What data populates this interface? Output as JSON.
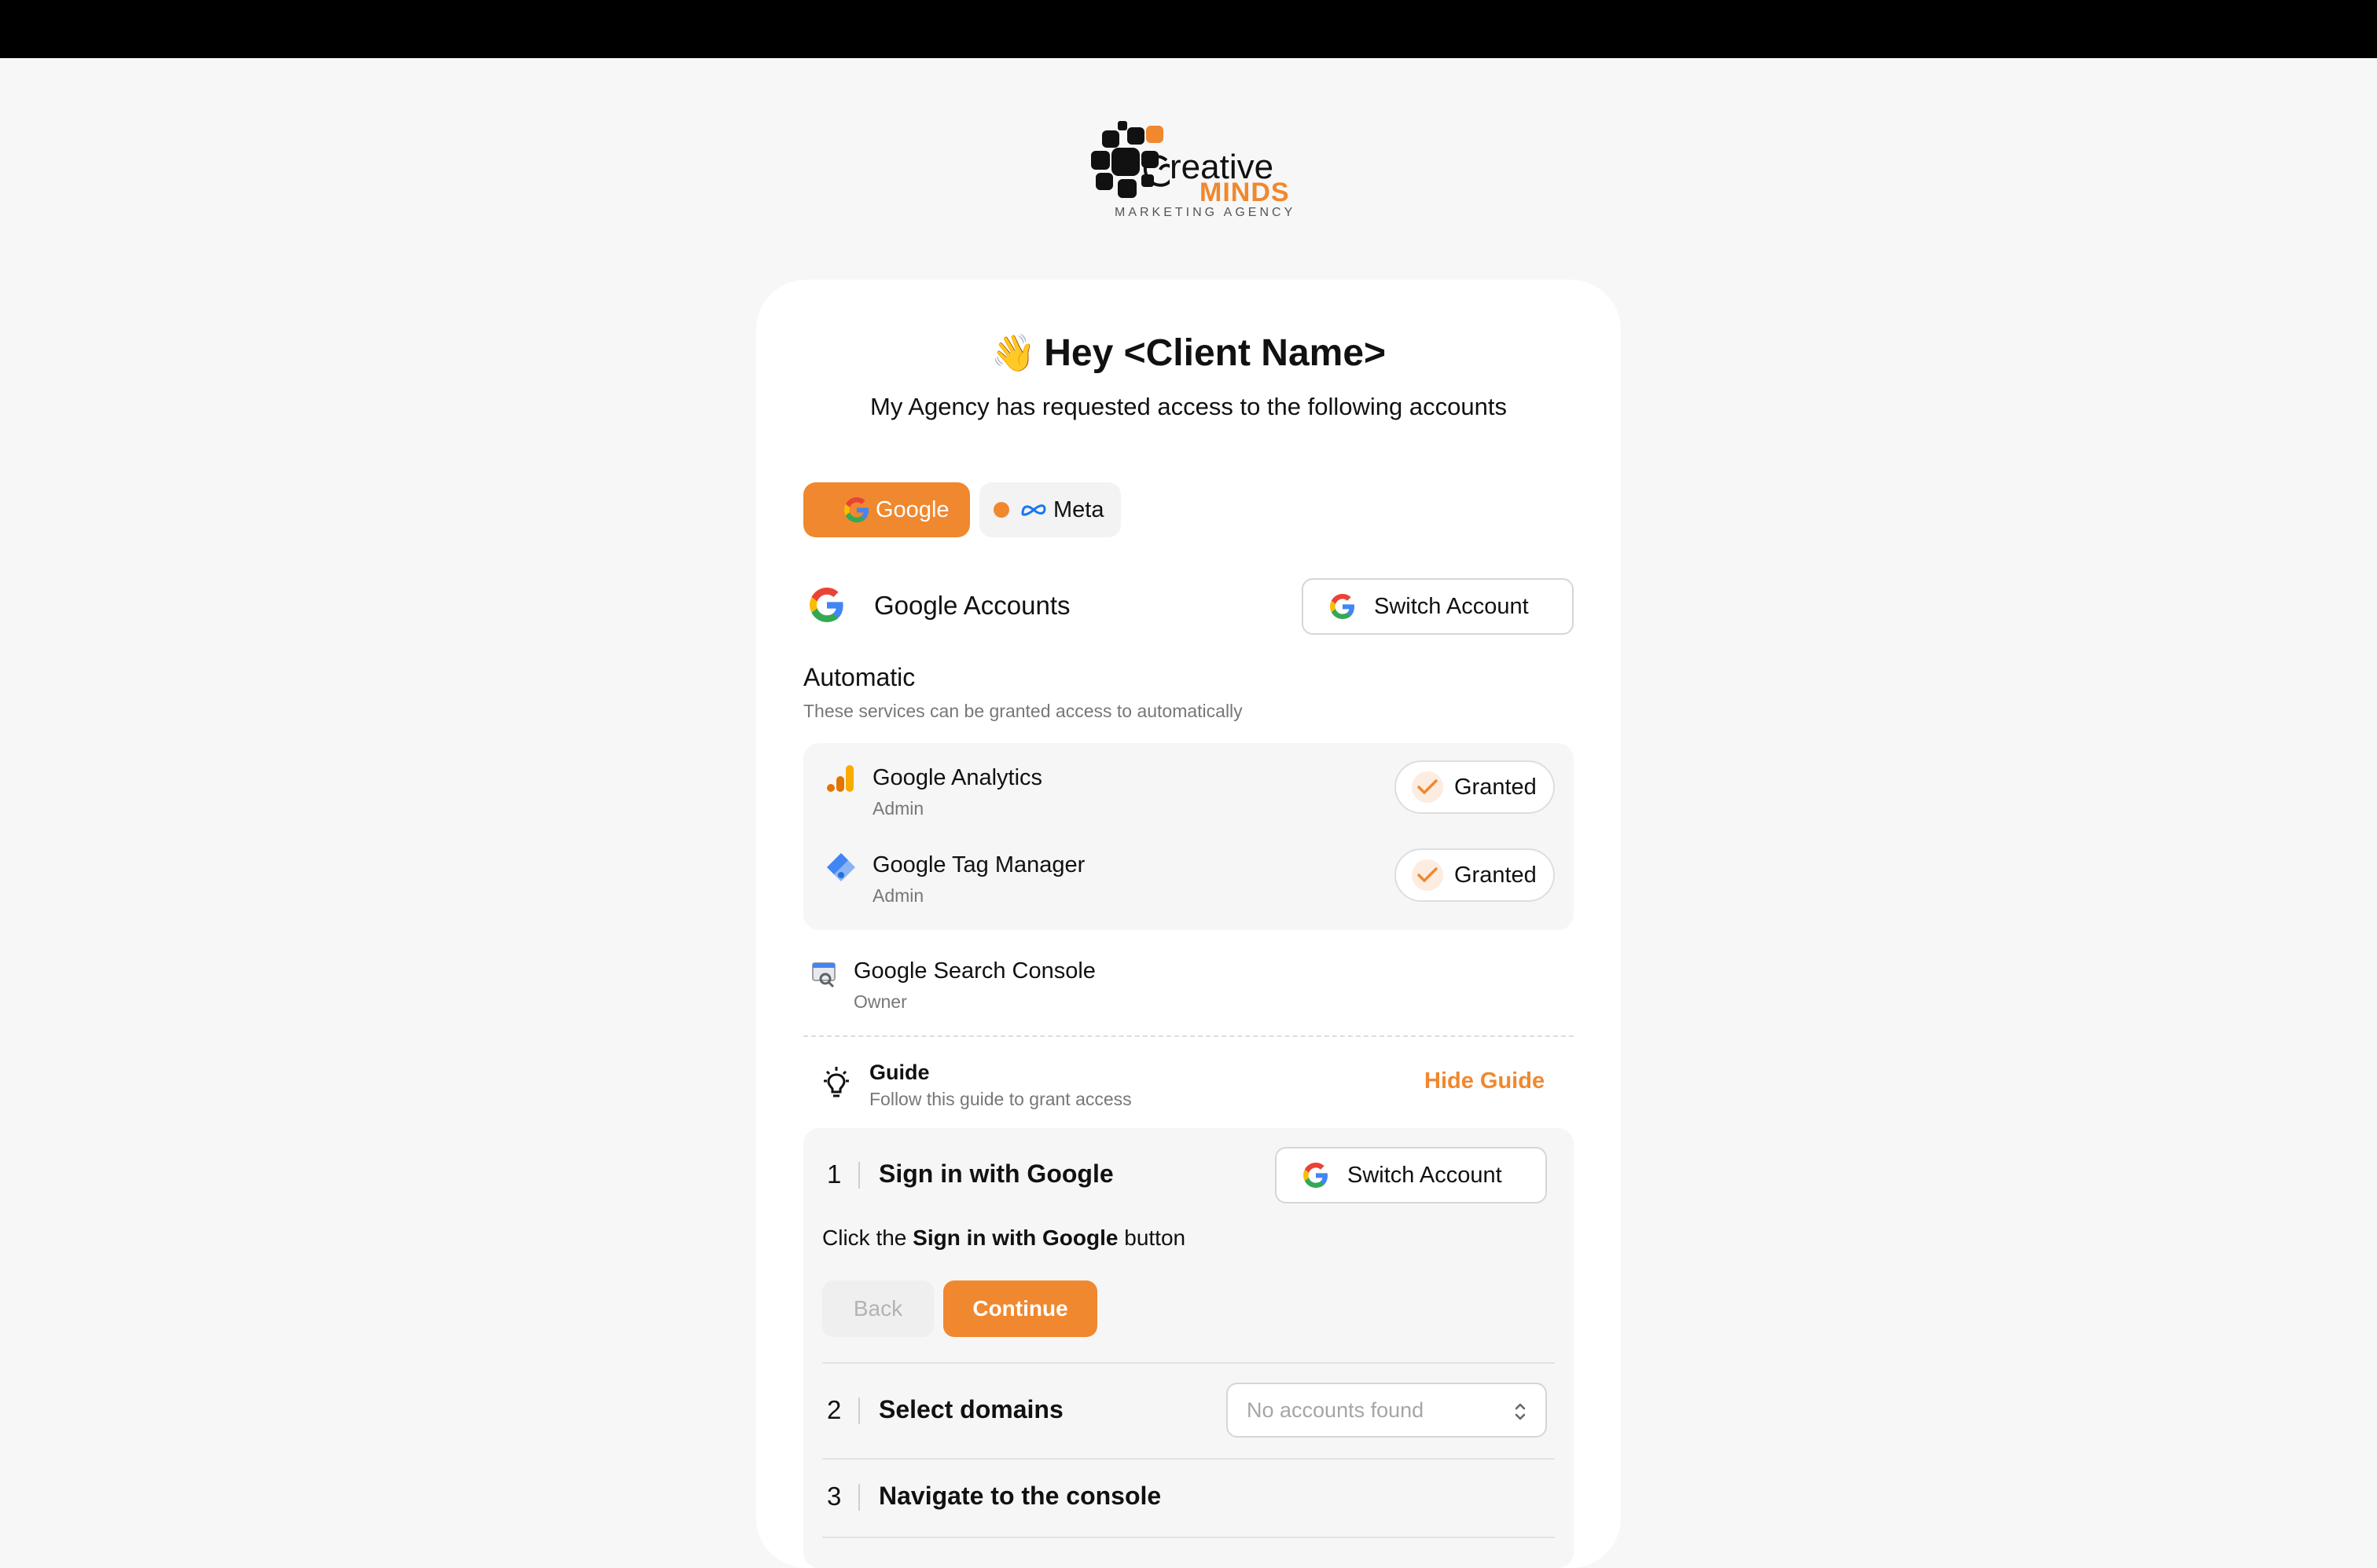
{
  "logo": {
    "line1": "reative",
    "line2": "MINDS",
    "line3": "MARKETING AGENCY"
  },
  "greeting": {
    "emoji": "👋",
    "title": "Hey <Client Name>",
    "subtitle": "My Agency has requested access to the following accounts"
  },
  "tabs": [
    {
      "label": "Google",
      "active": true
    },
    {
      "label": "Meta",
      "active": false
    }
  ],
  "account": {
    "title": "Google Accounts",
    "switch_label": "Switch Account"
  },
  "automatic": {
    "title": "Automatic",
    "subtitle": "These services can be granted access to automatically"
  },
  "services": [
    {
      "name": "Google Analytics",
      "role": "Admin",
      "status": "Granted",
      "icon": "google-analytics-icon"
    },
    {
      "name": "Google Tag Manager",
      "role": "Admin",
      "status": "Granted",
      "icon": "google-tag-manager-icon"
    },
    {
      "name": "Google Search Console",
      "role": "Owner",
      "icon": "google-search-console-icon"
    }
  ],
  "guide": {
    "title": "Guide",
    "subtitle": "Follow this guide to grant access",
    "hide_label": "Hide Guide",
    "steps": [
      {
        "number": "1",
        "title": "Sign in with Google",
        "button": "Switch Account"
      },
      {
        "number": "2",
        "title": "Select domains",
        "select_placeholder": "No accounts found"
      },
      {
        "number": "3",
        "title": "Navigate to the console"
      }
    ],
    "instruction_prefix": "Click the ",
    "instruction_bold": "Sign in with Google",
    "instruction_suffix": " button",
    "back_label": "Back",
    "continue_label": "Continue"
  },
  "colors": {
    "accent": "#f0882f",
    "topbar": "#000000",
    "background": "#f7f7f7"
  }
}
